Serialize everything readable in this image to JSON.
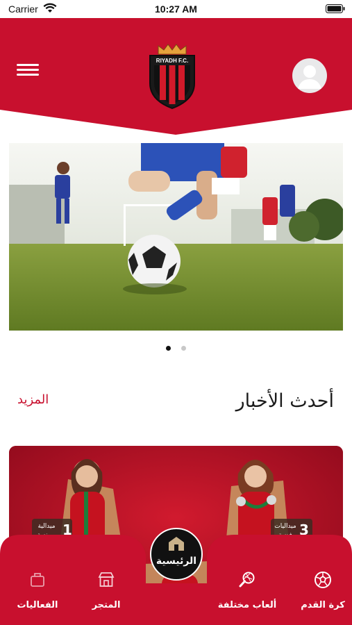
{
  "status_bar": {
    "carrier": "Carrier",
    "time": "10:27 AM"
  },
  "header": {
    "club_logo_text": "RIYADH F.C."
  },
  "carousel": {
    "slide_count": 2,
    "active_index": 0
  },
  "news": {
    "title": "أحدث الأخبار",
    "more_label": "المزيد",
    "card": {
      "left_badge": {
        "count": "1",
        "label_line1": "ميدالية",
        "label_line2": "برونزية"
      },
      "right_badge": {
        "count": "3",
        "label_line1": "ميداليات",
        "label_line2": "فضية"
      }
    }
  },
  "bottom_nav": {
    "items": [
      {
        "label": "كرة القدم",
        "icon": "football-icon"
      },
      {
        "label": "ألعاب مختلفة",
        "icon": "tennis-racket-icon"
      },
      {
        "label": "الرئيسية",
        "icon": "home-icon"
      },
      {
        "label": "المتجر",
        "icon": "store-icon"
      },
      {
        "label": "الفعاليات",
        "icon": "events-icon"
      }
    ]
  },
  "colors": {
    "brand_red": "#c8102e",
    "dark": "#111111"
  }
}
